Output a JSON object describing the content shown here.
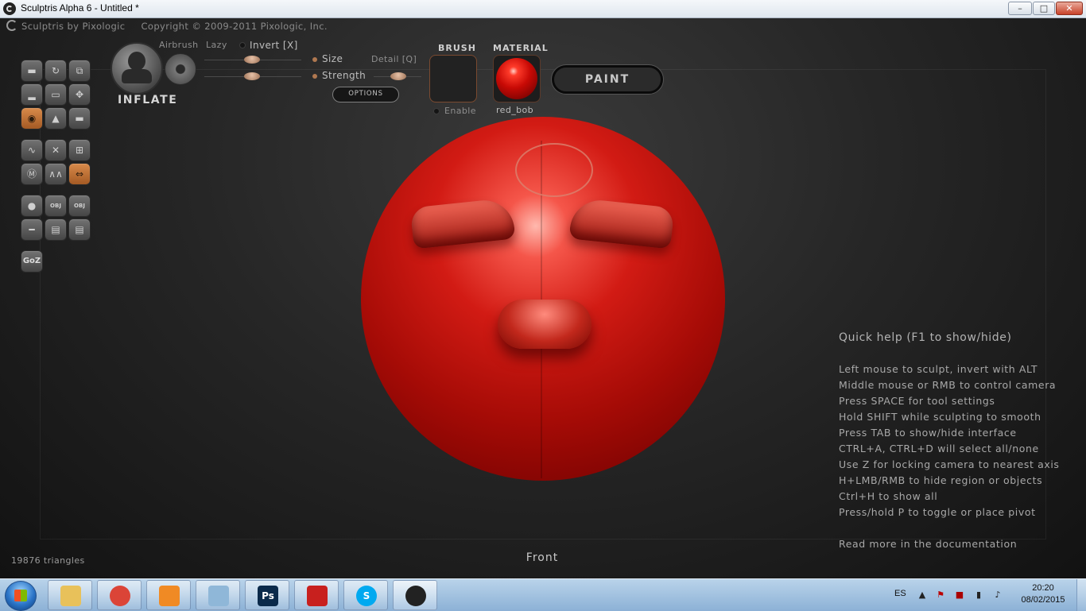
{
  "window": {
    "title": "Sculptris Alpha 6 - Untitled *",
    "controls": {
      "minimize": "–",
      "maximize": "□",
      "close": "✕"
    }
  },
  "app_header": {
    "name": "Sculptris by Pixologic",
    "copyright": "Copyright © 2009-2011 Pixologic, Inc."
  },
  "tools": [
    {
      "id": "draw",
      "icon": "draw-icon",
      "glyph": "▬"
    },
    {
      "id": "rotate",
      "icon": "rotate-icon",
      "glyph": "↻"
    },
    {
      "id": "scale",
      "icon": "scale-icon",
      "glyph": "⧉"
    },
    {
      "id": "flatten",
      "icon": "flatten-icon",
      "glyph": "▂"
    },
    {
      "id": "crease",
      "icon": "crease-icon",
      "glyph": "▭"
    },
    {
      "id": "grab",
      "icon": "grab-icon",
      "glyph": "✥"
    },
    {
      "id": "inflate",
      "icon": "inflate-icon",
      "glyph": "◉",
      "active": true
    },
    {
      "id": "pinch",
      "icon": "pinch-icon",
      "glyph": "▲"
    },
    {
      "id": "smooth",
      "icon": "smooth-icon",
      "glyph": "▬"
    },
    {
      "id": "reduce",
      "icon": "reduce-icon",
      "glyph": "∿"
    },
    {
      "id": "wireframe",
      "icon": "wireframe-icon",
      "glyph": "✕"
    },
    {
      "id": "grid",
      "icon": "grid-icon",
      "glyph": "⊞"
    },
    {
      "id": "mask",
      "icon": "mask-icon",
      "glyph": "Ⓜ"
    },
    {
      "id": "zigzag",
      "icon": "zigzag-icon",
      "glyph": "∧∧"
    },
    {
      "id": "symmetry",
      "icon": "symmetry-icon",
      "glyph": "⇔",
      "active": true
    },
    {
      "id": "sphere",
      "icon": "sphere-icon",
      "glyph": "●"
    },
    {
      "id": "import-obj",
      "icon": "import-obj-icon",
      "glyph": "OBJ"
    },
    {
      "id": "export-obj",
      "icon": "export-obj-icon",
      "glyph": "OBJ"
    },
    {
      "id": "plane",
      "icon": "plane-icon",
      "glyph": "━"
    },
    {
      "id": "open",
      "icon": "open-icon",
      "glyph": "▤"
    },
    {
      "id": "save",
      "icon": "save-icon",
      "glyph": "▤"
    },
    {
      "id": "goz",
      "icon": "goz-icon",
      "glyph": "GoZ"
    }
  ],
  "brush": {
    "name": "INFLATE",
    "airbrush_label": "Airbrush",
    "lazy_label": "Lazy",
    "invert_label": "Invert [X]",
    "size_label": "Size",
    "strength_label": "Strength",
    "detail_label": "Detail [Q]",
    "options_label": "OPTIONS"
  },
  "brush_panel": {
    "title": "BRUSH",
    "enable_label": "Enable"
  },
  "material_panel": {
    "title": "MATERIAL",
    "name": "red_bob"
  },
  "paint_button": "PAINT",
  "quick_help": {
    "title": "Quick help (F1 to show/hide)",
    "lines": [
      "Left mouse to sculpt, invert with ALT",
      "Middle mouse or RMB to control camera",
      "Press SPACE for tool settings",
      "Hold SHIFT while sculpting to smooth",
      "Press TAB to show/hide interface",
      "CTRL+A, CTRL+D will select all/none",
      "Use Z for locking camera to nearest axis",
      "H+LMB/RMB to hide region or objects",
      "Ctrl+H to show all",
      "Press/hold P to toggle or place pivot"
    ],
    "more": "Read more in the documentation"
  },
  "status": {
    "triangles": "19876 triangles",
    "view": "Front"
  },
  "colors": {
    "accent": "#c4702f",
    "sphere": "#c8140c"
  },
  "taskbar": {
    "items": [
      {
        "name": "explorer",
        "icon": "folder-icon",
        "color": "#e8c15a"
      },
      {
        "name": "chrome",
        "icon": "chrome-icon",
        "color": "#db4437"
      },
      {
        "name": "media-player",
        "icon": "media-player-icon",
        "color": "#f08a24"
      },
      {
        "name": "notes",
        "icon": "notes-icon",
        "color": "#8fb7d8"
      },
      {
        "name": "photoshop",
        "icon": "photoshop-icon",
        "color": "#0b2a4a",
        "glyph": "Ps"
      },
      {
        "name": "acrobat",
        "icon": "acrobat-icon",
        "color": "#c8201e"
      },
      {
        "name": "skype",
        "icon": "skype-icon",
        "color": "#00a9f0",
        "glyph": "S"
      },
      {
        "name": "sculptris",
        "icon": "sculptris-icon",
        "color": "#222222",
        "active": true
      }
    ],
    "language": "ES",
    "time": "20:20",
    "date": "08/02/2015"
  }
}
